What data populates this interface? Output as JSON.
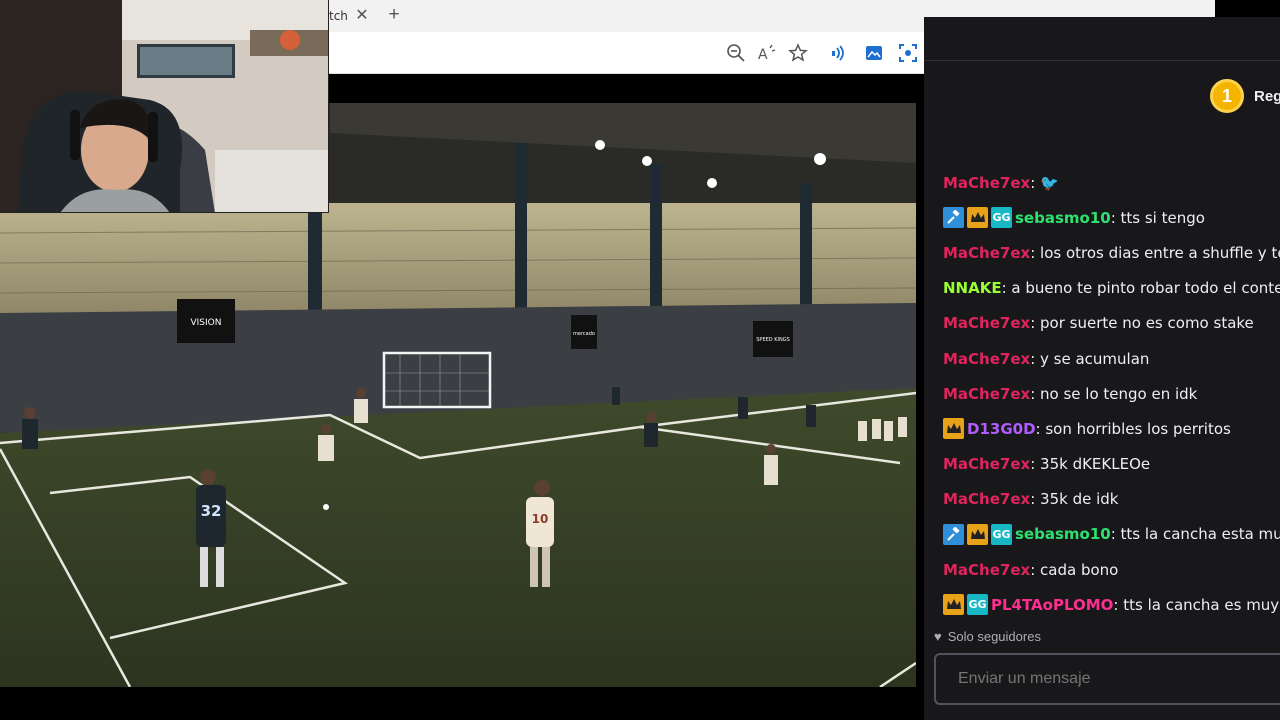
{
  "browser": {
    "tab_title": "tch",
    "tab_close_icon": "close-icon",
    "new_tab_icon": "plus-icon",
    "toolbar_icons": [
      "zoom-out-icon",
      "read-aloud-icon",
      "favorite-star-icon",
      "extension-audio-icon",
      "extension-image-icon",
      "extension-scan-icon"
    ]
  },
  "video": {
    "sponsors": [
      "VISION",
      "mercado",
      "SPEED KINGS"
    ],
    "player_number": "32",
    "player2_number": "10"
  },
  "chat": {
    "drops_number": "1",
    "drops_label": "Reg",
    "messages": [
      {
        "user": "MaChe7ex",
        "color": "#e0245e",
        "text": ": 🐦",
        "badges": []
      },
      {
        "user": "sebasmo10",
        "color": "#2ee06f",
        "text": ": tts si tengo",
        "badges": [
          "hammer",
          "crown",
          "gg"
        ]
      },
      {
        "user": "MaChe7ex",
        "color": "#e0245e",
        "text": ": los otros dias entre a shuffle y ten",
        "badges": []
      },
      {
        "user": "NNAKE",
        "color": "#9aff33",
        "text": ": a bueno te pinto robar todo el conten",
        "badges": []
      },
      {
        "user": "MaChe7ex",
        "color": "#e0245e",
        "text": ": por suerte no es como stake",
        "badges": []
      },
      {
        "user": "MaChe7ex",
        "color": "#e0245e",
        "text": ": y se acumulan",
        "badges": []
      },
      {
        "user": "MaChe7ex",
        "color": "#e0245e",
        "text": ": no se lo tengo en idk",
        "badges": []
      },
      {
        "user": "D13G0D",
        "color": "#b05cff",
        "text": ": son horribles los perritos",
        "badges": [
          "crown"
        ]
      },
      {
        "user": "MaChe7ex",
        "color": "#e0245e",
        "text": ": 35k dKEKLEOe",
        "badges": []
      },
      {
        "user": "MaChe7ex",
        "color": "#e0245e",
        "text": ": 35k de idk",
        "badges": []
      },
      {
        "user": "sebasmo10",
        "color": "#2ee06f",
        "text": ": tts la cancha esta muy",
        "badges": [
          "hammer",
          "crown",
          "gg"
        ]
      },
      {
        "user": "MaChe7ex",
        "color": "#e0245e",
        "text": ": cada bono",
        "badges": []
      },
      {
        "user": "PL4TAoPLOMO",
        "color": "#ff2f8f",
        "text": ": tts la cancha es muy m",
        "badges": [
          "crown",
          "gg"
        ]
      }
    ],
    "followers_only": "Solo seguidores",
    "input_placeholder": "Enviar un mensaje"
  }
}
